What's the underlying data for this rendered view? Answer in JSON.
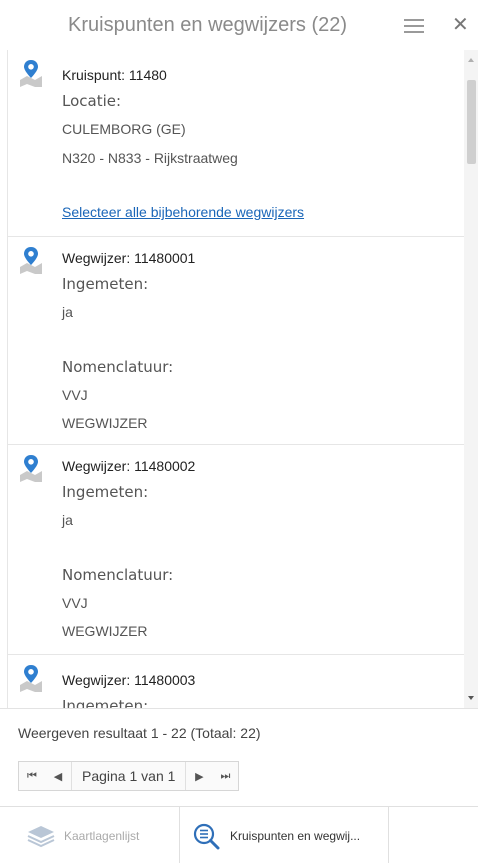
{
  "header": {
    "title": "Kruispunten en wegwijzers (22)"
  },
  "icons": {
    "pin": "map-pin-icon",
    "menu": "menu-icon",
    "close": "close-icon",
    "layers": "layers-icon",
    "search_list": "search-list-icon"
  },
  "colors": {
    "pin_blue": "#2f7fd0",
    "link": "#1a66b8"
  },
  "items": [
    {
      "title": "Kruispunt: 11480",
      "label1": "Locatie:",
      "value1a": "CULEMBORG (GE)",
      "value1b": "N320 - N833 - Rijkstraatweg",
      "link": "Selecteer alle bijbehorende wegwijzers"
    },
    {
      "title": "Wegwijzer: 11480001",
      "label1": "Ingemeten:",
      "value1": "ja",
      "label2": "Nomenclatuur:",
      "value2a": "VVJ",
      "value2b": "WEGWIJZER"
    },
    {
      "title": "Wegwijzer: 11480002",
      "label1": "Ingemeten:",
      "value1": "ja",
      "label2": "Nomenclatuur:",
      "value2a": "VVJ",
      "value2b": "WEGWIJZER"
    },
    {
      "title": "Wegwijzer: 11480003",
      "label1": "Ingemeten:"
    }
  ],
  "footer": {
    "result_text": "Weergeven resultaat 1 - 22 (Totaal: 22)",
    "pager": {
      "first": "⏮",
      "prev": "◀",
      "label": "Pagina 1 van 1",
      "next": "▶",
      "last": "⏭"
    }
  },
  "tabs": [
    {
      "label": "Kaartlagenlijst"
    },
    {
      "label": "Kruispunten en wegwij..."
    }
  ]
}
